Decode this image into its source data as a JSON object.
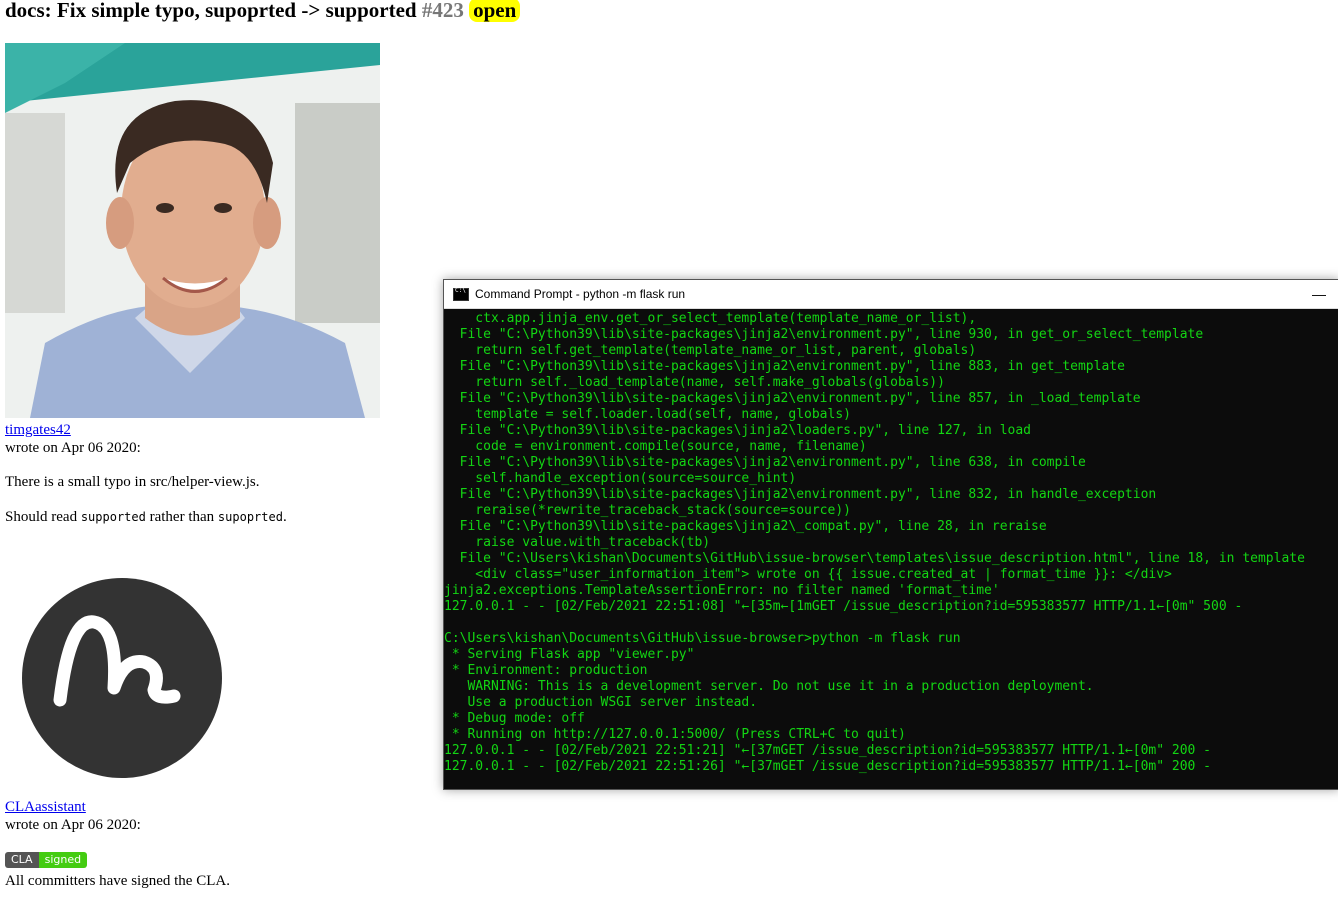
{
  "issue": {
    "title": "docs: Fix simple typo, supoprted -> supported",
    "number": "#423",
    "state": "open"
  },
  "comments": [
    {
      "author": "timgates42",
      "wrote": "wrote on Apr 06 2020:",
      "para1": "There is a small typo in src/helper-view.js.",
      "para2_pre": "Should read ",
      "para2_code1": "supported",
      "para2_mid": " rather than ",
      "para2_code2": "supoprted",
      "para2_post": "."
    },
    {
      "author": "CLAassistant",
      "wrote": "wrote on Apr 06 2020:",
      "badge_left": "CLA",
      "badge_right": "signed",
      "text": "All committers have signed the CLA."
    }
  ],
  "console": {
    "title": "Command Prompt - python  -m flask run",
    "minimize": "—",
    "lines": [
      "    ctx.app.jinja_env.get_or_select_template(template_name_or_list),",
      "  File \"C:\\Python39\\lib\\site-packages\\jinja2\\environment.py\", line 930, in get_or_select_template",
      "    return self.get_template(template_name_or_list, parent, globals)",
      "  File \"C:\\Python39\\lib\\site-packages\\jinja2\\environment.py\", line 883, in get_template",
      "    return self._load_template(name, self.make_globals(globals))",
      "  File \"C:\\Python39\\lib\\site-packages\\jinja2\\environment.py\", line 857, in _load_template",
      "    template = self.loader.load(self, name, globals)",
      "  File \"C:\\Python39\\lib\\site-packages\\jinja2\\loaders.py\", line 127, in load",
      "    code = environment.compile(source, name, filename)",
      "  File \"C:\\Python39\\lib\\site-packages\\jinja2\\environment.py\", line 638, in compile",
      "    self.handle_exception(source=source_hint)",
      "  File \"C:\\Python39\\lib\\site-packages\\jinja2\\environment.py\", line 832, in handle_exception",
      "    reraise(*rewrite_traceback_stack(source=source))",
      "  File \"C:\\Python39\\lib\\site-packages\\jinja2\\_compat.py\", line 28, in reraise",
      "    raise value.with_traceback(tb)",
      "  File \"C:\\Users\\kishan\\Documents\\GitHub\\issue-browser\\templates\\issue_description.html\", line 18, in template",
      "    <div class=\"user_information_item\"> wrote on {{ issue.created_at | format_time }}: </div>",
      "jinja2.exceptions.TemplateAssertionError: no filter named 'format_time'",
      "127.0.0.1 - - [02/Feb/2021 22:51:08] \"←[35m←[1mGET /issue_description?id=595383577 HTTP/1.1←[0m\" 500 -",
      "",
      "C:\\Users\\kishan\\Documents\\GitHub\\issue-browser>python -m flask run",
      " * Serving Flask app \"viewer.py\"",
      " * Environment: production",
      "   WARNING: This is a development server. Do not use it in a production deployment.",
      "   Use a production WSGI server instead.",
      " * Debug mode: off",
      " * Running on http://127.0.0.1:5000/ (Press CTRL+C to quit)",
      "127.0.0.1 - - [02/Feb/2021 22:51:21] \"←[37mGET /issue_description?id=595383577 HTTP/1.1←[0m\" 200 -",
      "127.0.0.1 - - [02/Feb/2021 22:51:26] \"←[37mGET /issue_description?id=595383577 HTTP/1.1←[0m\" 200 -"
    ]
  }
}
